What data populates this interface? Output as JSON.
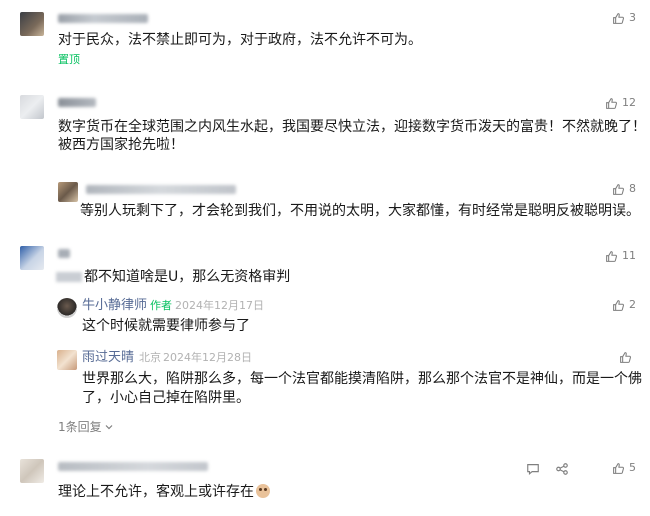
{
  "comments": [
    {
      "text": "对于民众，法不禁止即可为，对于政府，法不允许不可为。",
      "pin_label": "置顶",
      "likes": "3"
    },
    {
      "text_line1": "数字货币在全球范围之内风生水起，我国要尽快立法，迎接数字货币泼天的富贵！不然就晚了！",
      "text_line2": "被西方国家抢先啦！",
      "likes": "12",
      "replies": [
        {
          "text": "等别人玩剩下了，才会轮到我们，不用说的太明，大家都懂，有时经常是聪明反被聪明误。",
          "likes": "8"
        }
      ]
    },
    {
      "text": "都不知道啥是U，那么无资格审判",
      "likes": "11",
      "replies": [
        {
          "name": "牛小静律师",
          "author_tag": "作者",
          "date": "2024年12月17日",
          "text": "这个时候就需要律师参与了",
          "likes": "2"
        },
        {
          "name": "雨过天晴",
          "location": "北京",
          "date": "2024年12月28日",
          "text_line1": "世界那么大，陷阱那么多，每一个法官都能摸清陷阱，那么那个法官不是神仙，而是一个佛",
          "text_line2": "了，小心自己掉在陷阱里。"
        }
      ],
      "more_replies": "1条回复"
    },
    {
      "text": "理论上不允许，客观上或许存在",
      "likes": "5"
    }
  ],
  "icons": {
    "like": "thumbs-up-icon",
    "chevron": "chevron-down-icon",
    "comment": "comment-icon",
    "share": "share-icon"
  },
  "colors": {
    "name": "#576b95",
    "author_tag": "#07c160",
    "pin": "#07c160",
    "meta": "#b2b2b2",
    "text": "#191919"
  }
}
